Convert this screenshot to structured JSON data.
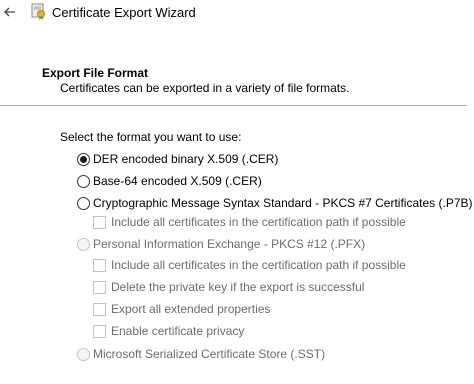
{
  "window": {
    "title": "Certificate Export Wizard",
    "back_icon": "back-arrow-icon",
    "app_icon": "certificate-icon"
  },
  "header": {
    "title": "Export File Format",
    "description": "Certificates can be exported in a variety of file formats."
  },
  "prompt": "Select the format you want to use:",
  "formats": [
    {
      "label": "DER encoded binary X.509 (.CER)",
      "selected": true,
      "enabled": true
    },
    {
      "label": "Base-64 encoded X.509 (.CER)",
      "selected": false,
      "enabled": true
    },
    {
      "label": "Cryptographic Message Syntax Standard - PKCS #7 Certificates (.P7B)",
      "selected": false,
      "enabled": true
    },
    {
      "label": "Personal Information Exchange - PKCS #12 (.PFX)",
      "selected": false,
      "enabled": false
    },
    {
      "label": "Microsoft Serialized Certificate Store (.SST)",
      "selected": false,
      "enabled": false
    }
  ],
  "p7b_options": [
    {
      "label": "Include all certificates in the certification path if possible",
      "checked": false,
      "enabled": false
    }
  ],
  "pfx_options": [
    {
      "label": "Include all certificates in the certification path if possible",
      "checked": false,
      "enabled": false
    },
    {
      "label": "Delete the private key if the export is successful",
      "checked": false,
      "enabled": false
    },
    {
      "label": "Export all extended properties",
      "checked": false,
      "enabled": false
    },
    {
      "label": "Enable certificate privacy",
      "checked": false,
      "enabled": false
    }
  ]
}
